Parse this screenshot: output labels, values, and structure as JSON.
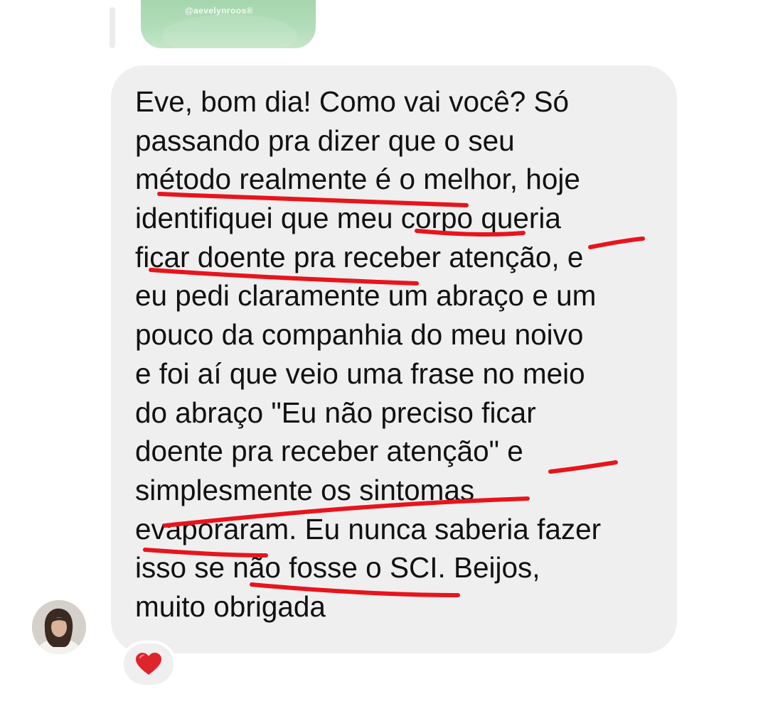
{
  "story_reply": {
    "handle": "@aevelynroos®"
  },
  "message": {
    "lines": [
      "Eve, bom dia! Como vai você? Só",
      "passando pra dizer que o seu",
      "método realmente é o melhor, hoje",
      "identifiquei que meu corpo queria",
      "ficar doente pra receber atenção, e",
      "eu pedi claramente um abraço e um",
      "pouco da companhia do meu noivo",
      "e foi aí que veio uma frase no meio",
      "do abraço \"Eu não preciso ficar",
      "doente pra receber atenção\" e",
      "simplesmente os sintomas",
      "evaporaram. Eu nunca saberia fazer",
      "isso se não fosse o SCI. Beijos,",
      "muito obrigada"
    ],
    "annotation_color": "#e8141c"
  },
  "sender": {
    "avatar_icon": "profile-photo"
  },
  "reaction": {
    "icon": "red-heart-icon",
    "color": "#e0242c"
  }
}
